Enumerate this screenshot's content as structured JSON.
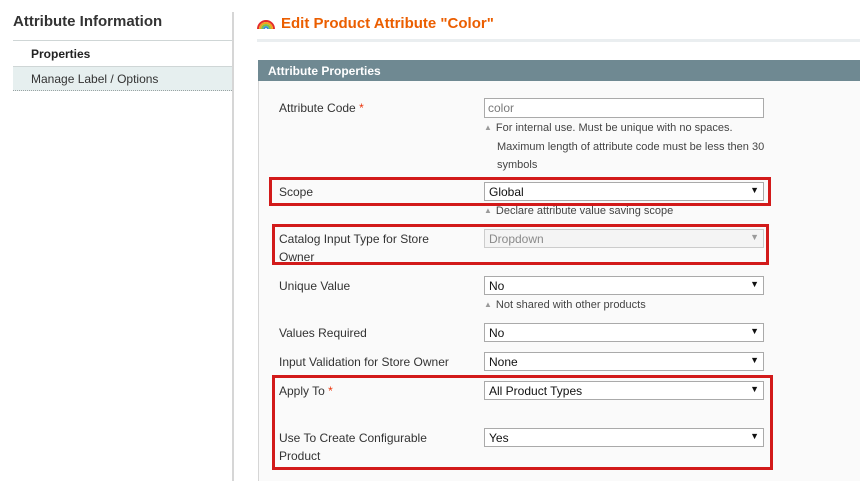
{
  "sidebar": {
    "title": "Attribute Information",
    "tabs": [
      {
        "label": "Properties",
        "active": true
      },
      {
        "label": "Manage Label / Options",
        "active": false
      }
    ]
  },
  "header": {
    "title": "Edit Product Attribute \"Color\"",
    "icon": "rainbow-icon"
  },
  "fieldset": {
    "title": "Attribute Properties"
  },
  "fields": {
    "attribute_code": {
      "label": "Attribute Code",
      "required": "*",
      "value": "color",
      "note_line1": "For internal use. Must be unique with no spaces.",
      "note_line2": "Maximum length of attribute code must be less then 30",
      "note_line3": "symbols"
    },
    "scope": {
      "label": "Scope",
      "value": "Global",
      "note": "Declare attribute value saving scope"
    },
    "catalog_input_type": {
      "label_line1": "Catalog Input Type for Store",
      "label_line2": "Owner",
      "value": "Dropdown"
    },
    "unique_value": {
      "label": "Unique Value",
      "value": "No",
      "note": "Not shared with other products"
    },
    "values_required": {
      "label": "Values Required",
      "value": "No"
    },
    "input_validation": {
      "label": "Input Validation for Store Owner",
      "value": "None"
    },
    "apply_to": {
      "label": "Apply To",
      "required": "*",
      "value": "All Product Types"
    },
    "use_configurable": {
      "label_line1": "Use To Create Configurable",
      "label_line2": "Product",
      "value": "Yes"
    }
  },
  "colors": {
    "title_orange": "#eb5e00",
    "fieldset_header": "#6f8992",
    "highlight_red": "#d21a1a",
    "tab_active_bg": "#e6efef"
  }
}
